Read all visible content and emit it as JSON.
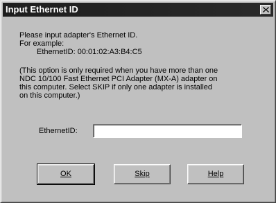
{
  "window": {
    "title": "Input Ethernet ID"
  },
  "intro": {
    "line1": "Please input adapter's Ethernet ID.",
    "line2": "For example:",
    "example": "EthernetID: 00:01:02:A3:B4:C5"
  },
  "note": {
    "line1": "(This option is only required when you have more than one",
    "line2": "NDC 10/100 Fast Ethernet PCI Adapter (MX-A) adapter on",
    "line3": "this computer.  Select SKIP if only one adapter is installed",
    "line4": "on this computer.)"
  },
  "form": {
    "label": "EthernetID:",
    "value": ""
  },
  "buttons": {
    "ok": "OK",
    "skip": "Skip",
    "help": "Help"
  }
}
